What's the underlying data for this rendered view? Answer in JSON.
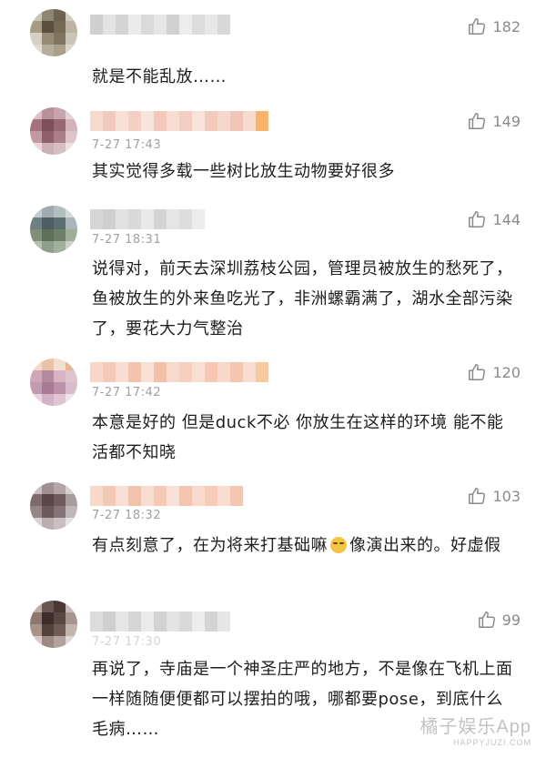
{
  "comments": [
    {
      "time": "",
      "likes": "182",
      "text": "就是不能乱放……"
    },
    {
      "time": "7-27 17:43",
      "likes": "149",
      "text": "其实觉得多载一些树比放生动物要好很多"
    },
    {
      "time": "7-27 18:31",
      "likes": "144",
      "text": "说得对，前天去深圳荔枝公园，管理员被放生的愁死了，鱼被放生的外来鱼吃光了，非洲螺霸满了，湖水全部污染了，要花大力气整治"
    },
    {
      "time": "7-27 17:42",
      "likes": "120",
      "text": "本意是好的 但是duck不必 你放生在这样的环境 能不能活都不知晓"
    },
    {
      "time": "7-27 18:32",
      "likes": "103",
      "text_before": "有点刻意了，在为将来打基础嘛",
      "text_after": "像演出来的。好虚假"
    },
    {
      "time": "7-27 17:30",
      "likes": "99",
      "text": "再说了，寺庙是一个神圣庄严的地方，不是像在飞机上面一样随随便便都可以摆拍的哦，哪都要pose，到底什么毛病……"
    }
  ],
  "watermark": {
    "main": "橘子娱乐App",
    "sub": "HAPPYJUZI.COM"
  },
  "icons": {
    "like": "thumbs-up-icon",
    "emoji": "smirk-emoji-icon"
  }
}
